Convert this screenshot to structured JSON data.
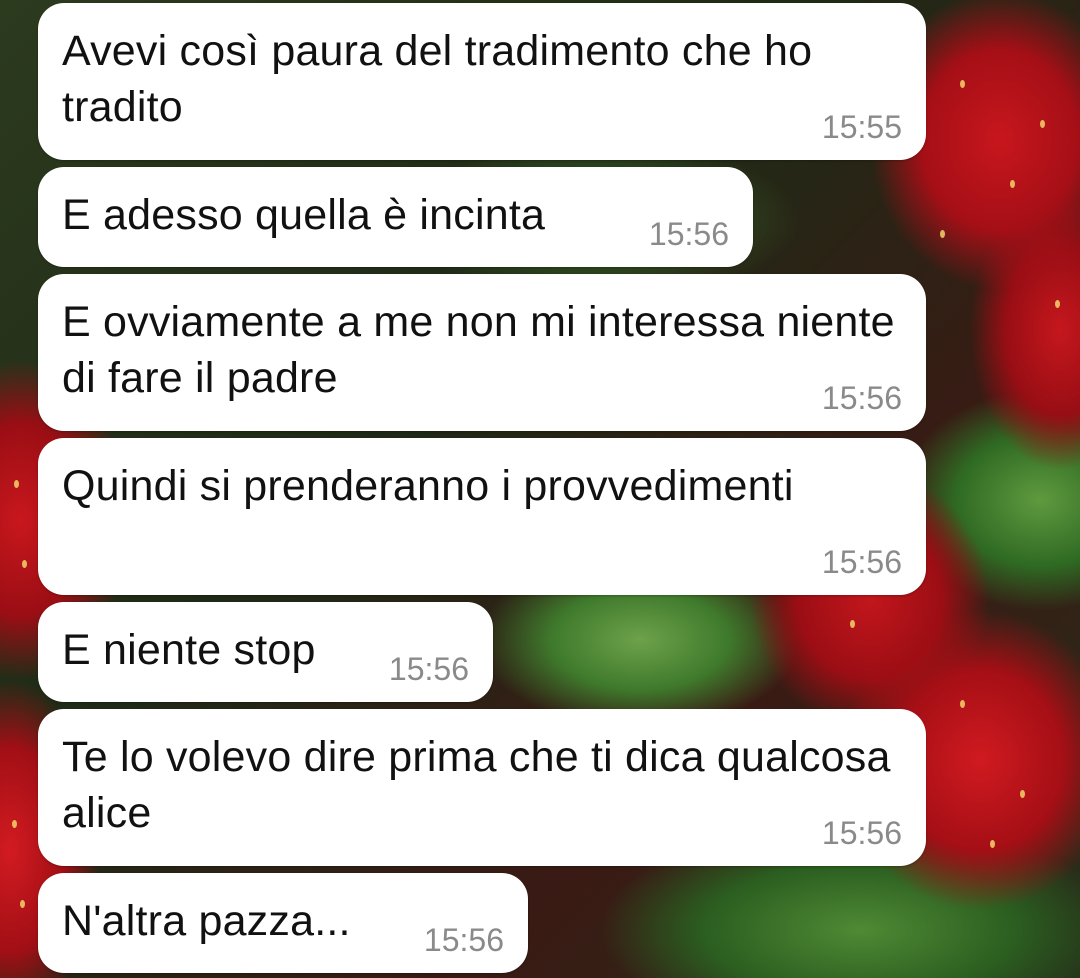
{
  "wallpaper": {
    "theme": "strawberries-icon",
    "colors": {
      "strawberry_red": "#c8161d",
      "leaf_green": "#4f8a34",
      "bubble_bg": "#ffffff",
      "time_color": "#8a8a8a",
      "text_color": "#111111"
    }
  },
  "messages": [
    {
      "text": "Avevi così paura del tradimento che ho tradito",
      "time": "15:55"
    },
    {
      "text": "E adesso quella è incinta",
      "time": "15:56"
    },
    {
      "text": "E ovviamente a me non mi interessa niente di fare il padre",
      "time": "15:56"
    },
    {
      "text": "Quindi si prenderanno i provvedimenti",
      "time": "15:56"
    },
    {
      "text": "E niente stop",
      "time": "15:56"
    },
    {
      "text": "Te lo volevo dire prima che ti dica qualcosa alice",
      "time": "15:56"
    },
    {
      "text": "N'altra pazza...",
      "time": "15:56"
    }
  ]
}
